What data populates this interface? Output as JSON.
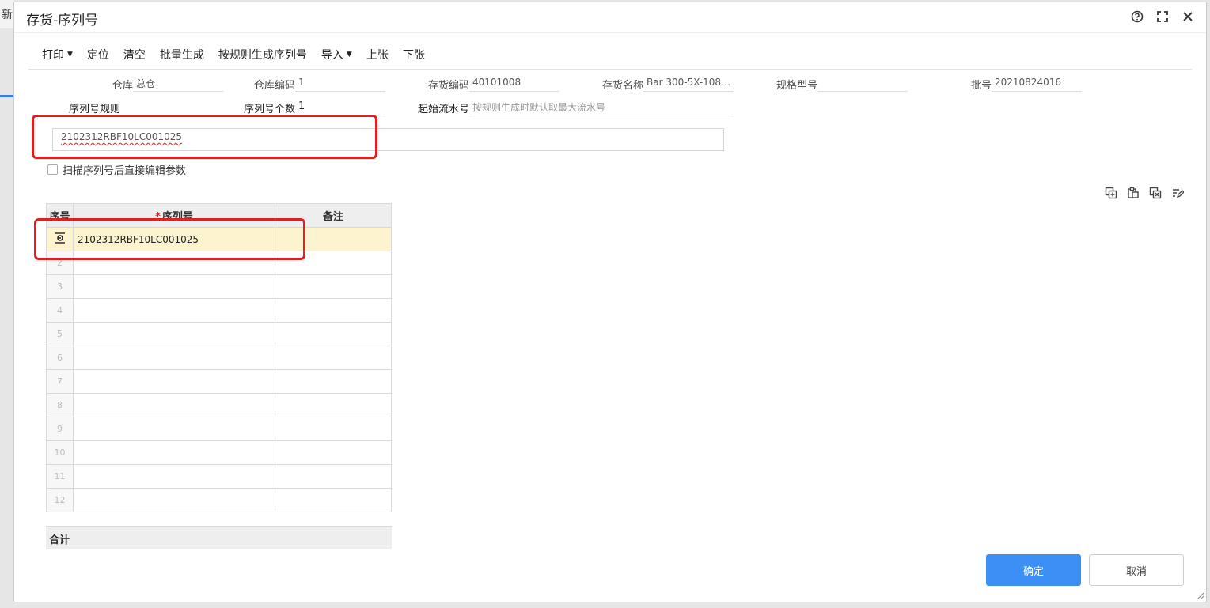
{
  "background": {
    "tab_label": "新"
  },
  "dialog": {
    "title": "存货-序列号",
    "help_icon": "help-circle-icon",
    "maximize_icon": "maximize-icon",
    "close_icon": "close-icon"
  },
  "toolbar": {
    "print": "打印",
    "locate": "定位",
    "clear": "清空",
    "batch_generate": "批量生成",
    "rule_generate": "按规则生成序列号",
    "import": "导入",
    "prev": "上张",
    "next": "下张"
  },
  "fields": {
    "warehouse": {
      "label": "仓库",
      "value": "总仓"
    },
    "warehouse_code": {
      "label": "仓库编码",
      "value": "1"
    },
    "inventory_code": {
      "label": "存货编码",
      "value": "40101008"
    },
    "inventory_name": {
      "label": "存货名称",
      "value": "Bar 300-5X-1080..."
    },
    "spec_model": {
      "label": "规格型号",
      "value": ""
    },
    "batch_no": {
      "label": "批号",
      "value": "20210824016"
    },
    "serial_rule": {
      "label": "序列号规则",
      "value": ""
    },
    "serial_count": {
      "label": "序列号个数",
      "value": "1"
    },
    "start_seq": {
      "label": "起始流水号",
      "placeholder": "按规则生成时默认取最大流水号"
    }
  },
  "scan_input": {
    "value": "2102312RBF10LC001025"
  },
  "checkbox": {
    "label": "扫描序列号后直接编辑参数",
    "checked": false
  },
  "grid": {
    "headers": {
      "index": "序号",
      "serial": "序列号",
      "note": "备注"
    },
    "required_mark": "*",
    "rows": [
      {
        "index": "",
        "serial": "2102312RBF10LC001025",
        "note": ""
      },
      {
        "index": "2",
        "serial": "",
        "note": ""
      },
      {
        "index": "3",
        "serial": "",
        "note": ""
      },
      {
        "index": "4",
        "serial": "",
        "note": ""
      },
      {
        "index": "5",
        "serial": "",
        "note": ""
      },
      {
        "index": "6",
        "serial": "",
        "note": ""
      },
      {
        "index": "7",
        "serial": "",
        "note": ""
      },
      {
        "index": "8",
        "serial": "",
        "note": ""
      },
      {
        "index": "9",
        "serial": "",
        "note": ""
      },
      {
        "index": "10",
        "serial": "",
        "note": ""
      },
      {
        "index": "11",
        "serial": "",
        "note": ""
      },
      {
        "index": "12",
        "serial": "",
        "note": ""
      }
    ],
    "total_label": "合计"
  },
  "buttons": {
    "ok": "确定",
    "cancel": "取消"
  },
  "colors": {
    "primary": "#3b8ff5",
    "highlight_row": "#fdf4cf",
    "annotation_red": "#e02020"
  }
}
